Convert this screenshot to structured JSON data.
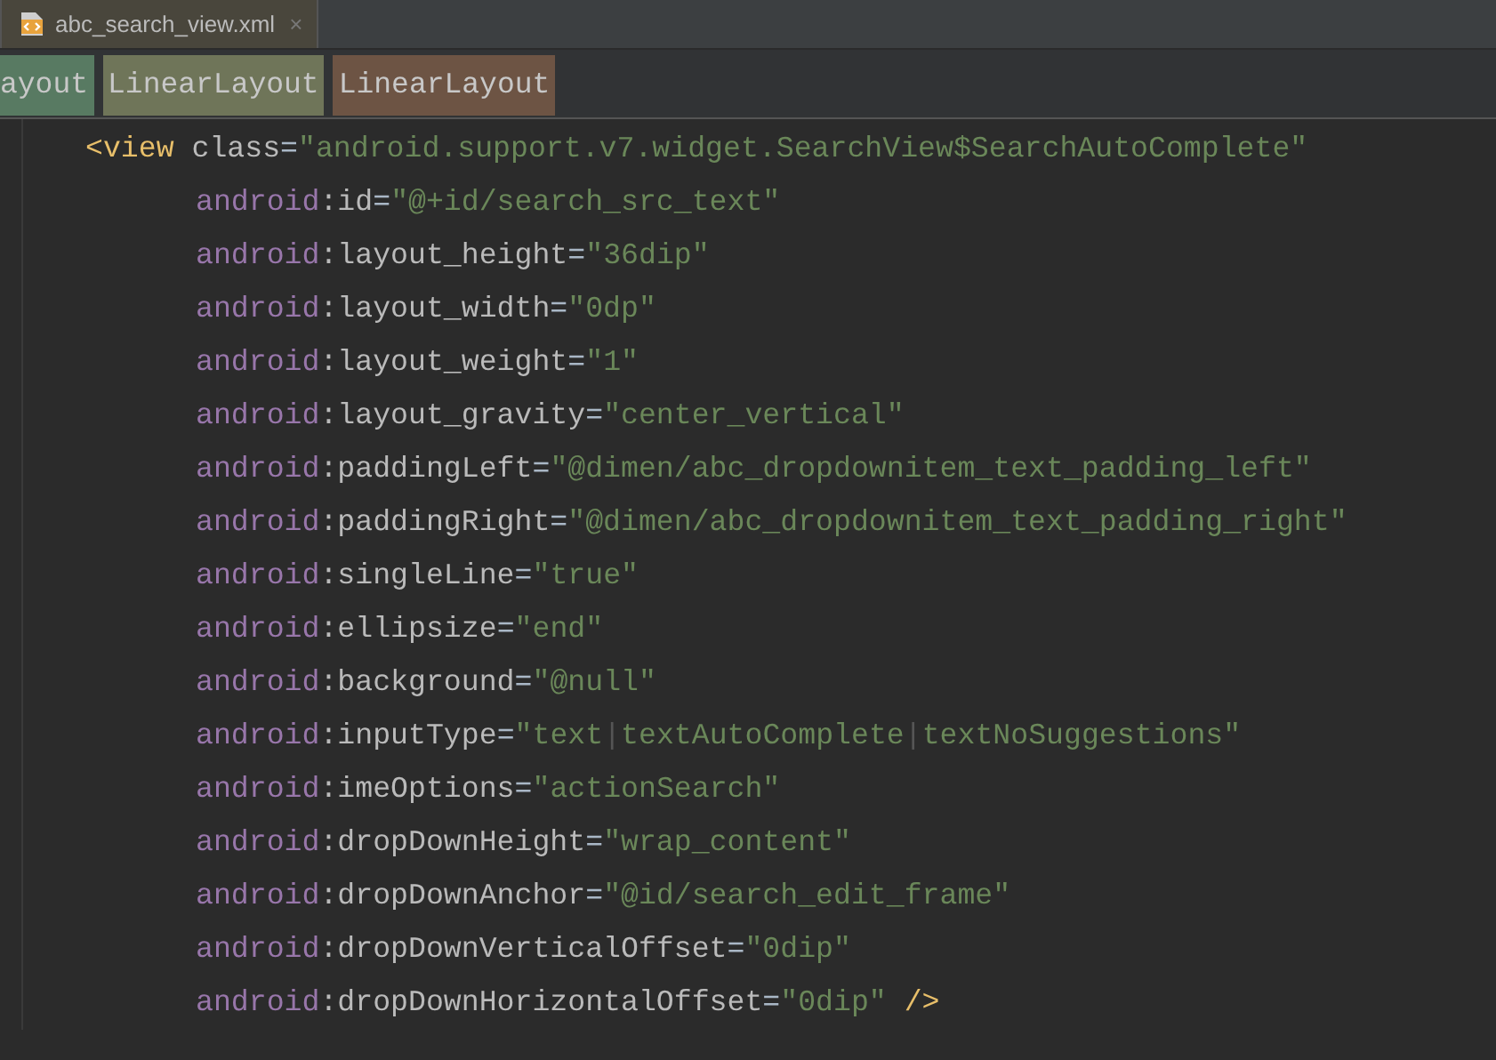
{
  "tabs": [
    {
      "label": "abc_search_view.xml",
      "close": "×",
      "selected": true
    }
  ],
  "breadcrumbs": [
    {
      "label": "ayout",
      "color": "#587a62"
    },
    {
      "label": "LinearLayout",
      "color": "#6f7559"
    },
    {
      "label": "LinearLayout",
      "color": "#6d5444"
    }
  ],
  "code_lines": [
    {
      "tokens": [
        {
          "kind": "tag",
          "text": "<view"
        },
        {
          "kind": "attr",
          "text": " class"
        },
        {
          "kind": "punct",
          "text": "="
        },
        {
          "kind": "value",
          "text": "\"android.support.v7.widget.SearchView$SearchAutoComplete\""
        }
      ],
      "children": [
        {
          "tokens": [
            {
              "kind": "ns",
              "text": "android"
            },
            {
              "kind": "attr",
              "text": ":id"
            },
            {
              "kind": "punct",
              "text": "="
            },
            {
              "kind": "value",
              "text": "\"@+id/search_src_text\""
            }
          ]
        },
        {
          "tokens": [
            {
              "kind": "ns",
              "text": "android"
            },
            {
              "kind": "attr",
              "text": ":layout_height"
            },
            {
              "kind": "punct",
              "text": "="
            },
            {
              "kind": "value",
              "text": "\"36dip\""
            }
          ]
        },
        {
          "tokens": [
            {
              "kind": "ns",
              "text": "android"
            },
            {
              "kind": "attr",
              "text": ":layout_width"
            },
            {
              "kind": "punct",
              "text": "="
            },
            {
              "kind": "value",
              "text": "\"0dp\""
            }
          ]
        },
        {
          "tokens": [
            {
              "kind": "ns",
              "text": "android"
            },
            {
              "kind": "attr",
              "text": ":layout_weight"
            },
            {
              "kind": "punct",
              "text": "="
            },
            {
              "kind": "value",
              "text": "\"1\""
            }
          ]
        },
        {
          "tokens": [
            {
              "kind": "ns",
              "text": "android"
            },
            {
              "kind": "attr",
              "text": ":layout_gravity"
            },
            {
              "kind": "punct",
              "text": "="
            },
            {
              "kind": "value",
              "text": "\"center_vertical\""
            }
          ]
        },
        {
          "tokens": [
            {
              "kind": "ns",
              "text": "android"
            },
            {
              "kind": "attr",
              "text": ":paddingLeft"
            },
            {
              "kind": "punct",
              "text": "="
            },
            {
              "kind": "value",
              "text": "\"@dimen/abc_dropdownitem_text_padding_left\""
            }
          ]
        },
        {
          "tokens": [
            {
              "kind": "ns",
              "text": "android"
            },
            {
              "kind": "attr",
              "text": ":paddingRight"
            },
            {
              "kind": "punct",
              "text": "="
            },
            {
              "kind": "value",
              "text": "\"@dimen/abc_dropdownitem_text_padding_right\""
            }
          ]
        },
        {
          "tokens": [
            {
              "kind": "ns",
              "text": "android"
            },
            {
              "kind": "attr",
              "text": ":singleLine"
            },
            {
              "kind": "punct",
              "text": "="
            },
            {
              "kind": "value",
              "text": "\"true\""
            }
          ]
        },
        {
          "tokens": [
            {
              "kind": "ns",
              "text": "android"
            },
            {
              "kind": "attr",
              "text": ":ellipsize"
            },
            {
              "kind": "punct",
              "text": "="
            },
            {
              "kind": "value",
              "text": "\"end\""
            }
          ]
        },
        {
          "tokens": [
            {
              "kind": "ns",
              "text": "android"
            },
            {
              "kind": "attr",
              "text": ":background"
            },
            {
              "kind": "punct",
              "text": "="
            },
            {
              "kind": "value",
              "text": "\"@null\""
            }
          ]
        },
        {
          "tokens": [
            {
              "kind": "ns",
              "text": "android"
            },
            {
              "kind": "attr",
              "text": ":inputType"
            },
            {
              "kind": "punct",
              "text": "="
            },
            {
              "kind": "value",
              "text": "\"text"
            },
            {
              "kind": "sep",
              "text": "|"
            },
            {
              "kind": "value",
              "text": "textAutoComplete"
            },
            {
              "kind": "sep",
              "text": "|"
            },
            {
              "kind": "value",
              "text": "textNoSuggestions\""
            }
          ]
        },
        {
          "tokens": [
            {
              "kind": "ns",
              "text": "android"
            },
            {
              "kind": "attr",
              "text": ":imeOptions"
            },
            {
              "kind": "punct",
              "text": "="
            },
            {
              "kind": "value",
              "text": "\"actionSearch\""
            }
          ]
        },
        {
          "tokens": [
            {
              "kind": "ns",
              "text": "android"
            },
            {
              "kind": "attr",
              "text": ":dropDownHeight"
            },
            {
              "kind": "punct",
              "text": "="
            },
            {
              "kind": "value",
              "text": "\"wrap_content\""
            }
          ]
        },
        {
          "tokens": [
            {
              "kind": "ns",
              "text": "android"
            },
            {
              "kind": "attr",
              "text": ":dropDownAnchor"
            },
            {
              "kind": "punct",
              "text": "="
            },
            {
              "kind": "value",
              "text": "\"@id/search_edit_frame\""
            }
          ]
        },
        {
          "tokens": [
            {
              "kind": "ns",
              "text": "android"
            },
            {
              "kind": "attr",
              "text": ":dropDownVerticalOffset"
            },
            {
              "kind": "punct",
              "text": "="
            },
            {
              "kind": "value",
              "text": "\"0dip\""
            }
          ]
        },
        {
          "tokens": [
            {
              "kind": "ns",
              "text": "android"
            },
            {
              "kind": "attr",
              "text": ":dropDownHorizontalOffset"
            },
            {
              "kind": "punct",
              "text": "="
            },
            {
              "kind": "value",
              "text": "\"0dip\""
            },
            {
              "kind": "tag",
              "text": " />"
            }
          ]
        }
      ]
    }
  ]
}
